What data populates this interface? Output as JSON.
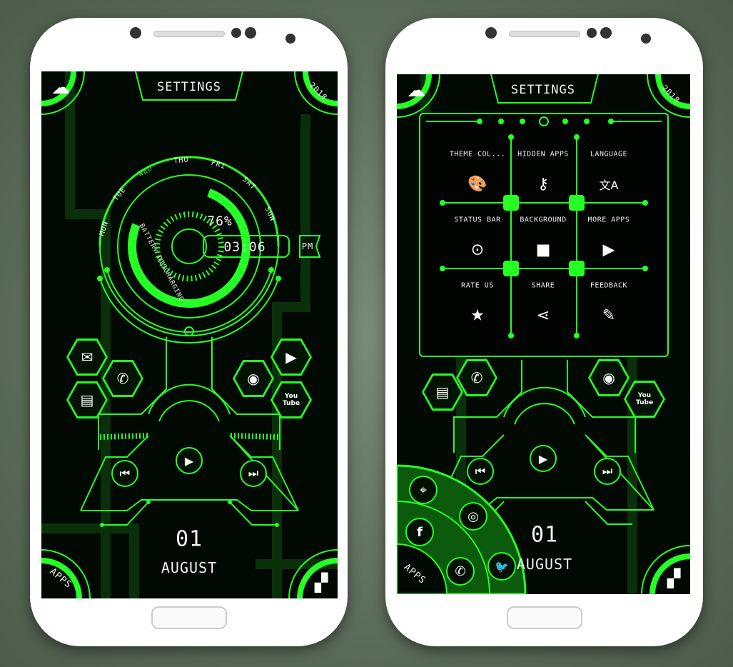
{
  "colors": {
    "accent": "#25ff25",
    "background": "#020802",
    "device": "#ffffff"
  },
  "left_phone": {
    "header": {
      "settings_label": "SETTINGS",
      "year": "2018",
      "cloud_icon": "cloud-icon"
    },
    "days": [
      "MON",
      "TUE",
      "WED",
      "THU",
      "FRI",
      "SAT",
      "SUN"
    ],
    "active_day": "WED",
    "battery": {
      "percent": "76%",
      "status": "BATTERY DISCHARGING",
      "level": 0.76
    },
    "clock": {
      "time": "03:06",
      "ampm": "PM"
    },
    "left_apps": [
      {
        "icon": "mail-icon",
        "glyph": "✉"
      },
      {
        "icon": "phone-icon",
        "glyph": "✆"
      },
      {
        "icon": "message-icon",
        "glyph": "▤"
      }
    ],
    "right_apps": [
      {
        "icon": "chrome-icon",
        "glyph": "◉"
      },
      {
        "icon": "store-icon",
        "glyph": "▶"
      },
      {
        "icon": "youtube-icon",
        "label_top": "You",
        "label_bottom": "Tube"
      }
    ],
    "media": {
      "prev": "⏮",
      "play": "▶",
      "next": "⏭"
    },
    "date": {
      "day": "01",
      "month": "AUGUST"
    },
    "apps_label": "APPS",
    "widgets_icon": "widgets-icon"
  },
  "right_phone": {
    "header": {
      "settings_label": "SETTINGS",
      "year": "2018"
    },
    "settings_menu": [
      {
        "label": "THEME COL...",
        "icon": "palette-icon",
        "glyph": "🎨"
      },
      {
        "label": "HIDDEN APPS",
        "icon": "key-icon",
        "glyph": "⚷"
      },
      {
        "label": "LANGUAGE",
        "icon": "translate-icon",
        "glyph": "文A"
      },
      {
        "label": "STATUS BAR",
        "icon": "toggle-icon",
        "glyph": "⊙"
      },
      {
        "label": "BACKGROUND",
        "icon": "background-icon",
        "glyph": "■"
      },
      {
        "label": "MORE APPS",
        "icon": "more-apps-icon",
        "glyph": "▶"
      },
      {
        "label": "RATE US",
        "icon": "star-icon",
        "glyph": "★"
      },
      {
        "label": "SHARE",
        "icon": "share-icon",
        "glyph": "⋖"
      },
      {
        "label": "FEEDBACK",
        "icon": "feedback-icon",
        "glyph": "✎"
      }
    ],
    "social": [
      {
        "icon": "maps-icon",
        "glyph": "⌖"
      },
      {
        "icon": "facebook-icon",
        "glyph": "f"
      },
      {
        "icon": "instagram-icon",
        "glyph": "◎"
      },
      {
        "icon": "whatsapp-icon",
        "glyph": "✆"
      },
      {
        "icon": "twitter-icon",
        "glyph": "🐦"
      }
    ],
    "youtube": {
      "label_top": "You",
      "label_bottom": "Tube"
    },
    "date": {
      "day": "01",
      "month": "AUGUST"
    },
    "apps_label": "APPS"
  }
}
